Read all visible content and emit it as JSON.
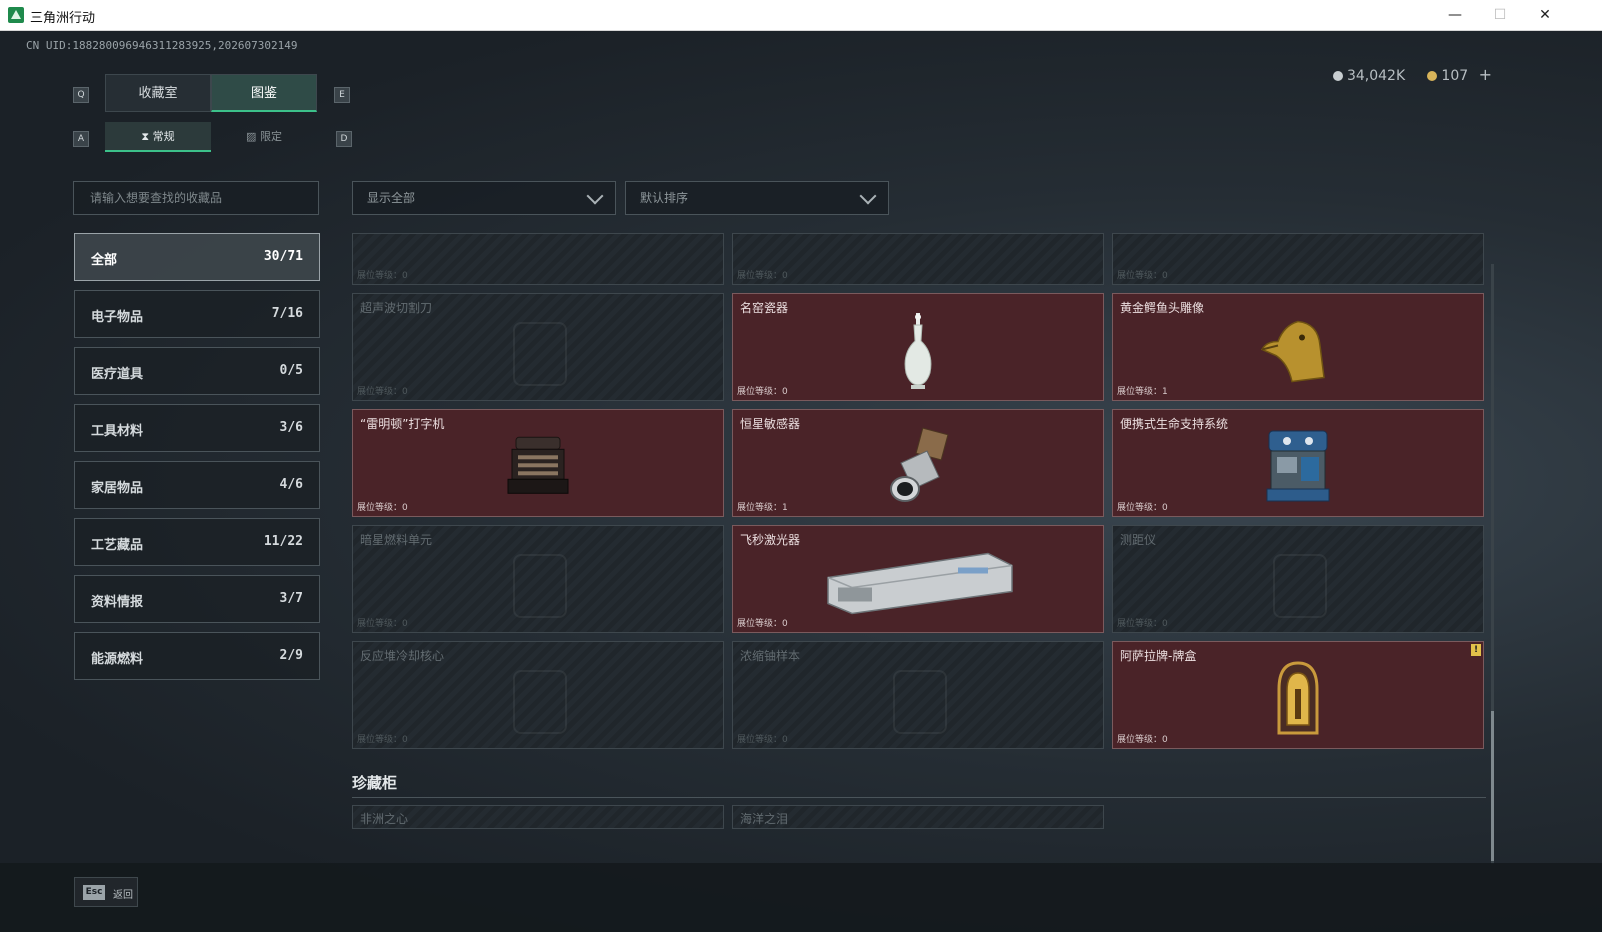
{
  "window": {
    "title": "三角洲行动",
    "minimize": "—",
    "maximize": "☐",
    "close": "✕"
  },
  "header": {
    "uid": "CN UID:188280096946311283925,202607302149",
    "currency": [
      {
        "value": "34,042K",
        "color": "#c8ced1"
      },
      {
        "value": "107",
        "color": "#d8b45a"
      }
    ],
    "add_label": "+"
  },
  "tabs": {
    "key_left": "Q",
    "key_right": "E",
    "items": [
      {
        "label": "收藏室",
        "active": false
      },
      {
        "label": "图鉴",
        "active": true
      }
    ]
  },
  "subtabs": {
    "key_left": "A",
    "key_right": "D",
    "items": [
      {
        "label": "常规",
        "icon": "hourglass-icon",
        "active": true
      },
      {
        "label": "限定",
        "icon": "image-icon",
        "active": false
      }
    ]
  },
  "search": {
    "placeholder": "请输入想要查找的收藏品"
  },
  "filters": {
    "display": "显示全部",
    "sort": "默认排序"
  },
  "categories": [
    {
      "label": "全部",
      "count": "30/71",
      "active": true
    },
    {
      "label": "电子物品",
      "count": "7/16",
      "active": false
    },
    {
      "label": "医疗道具",
      "count": "0/5",
      "active": false
    },
    {
      "label": "工具材料",
      "count": "3/6",
      "active": false
    },
    {
      "label": "家居物品",
      "count": "4/6",
      "active": false
    },
    {
      "label": "工艺藏品",
      "count": "11/22",
      "active": false
    },
    {
      "label": "资料情报",
      "count": "3/7",
      "active": false
    },
    {
      "label": "能源燃料",
      "count": "2/9",
      "active": false
    }
  ],
  "grid": {
    "partial_row": [
      {
        "level": "展位等级：0"
      },
      {
        "level": "展位等级：0"
      },
      {
        "level": "展位等级：0"
      }
    ],
    "items": [
      {
        "name": "超声波切割刀",
        "level": "展位等级：0",
        "owned": false
      },
      {
        "name": "名窑瓷器",
        "level": "展位等级：0",
        "owned": true,
        "icon": "vase-icon"
      },
      {
        "name": "黄金鳄鱼头雕像",
        "level": "展位等级：1",
        "owned": true,
        "icon": "gold-crocodile-icon"
      },
      {
        "name": "“雷明顿”打字机",
        "level": "展位等级：0",
        "owned": true,
        "icon": "typewriter-icon"
      },
      {
        "name": "恒星敏感器",
        "level": "展位等级：1",
        "owned": true,
        "icon": "star-sensor-icon"
      },
      {
        "name": "便携式生命支持系统",
        "level": "展位等级：0",
        "owned": true,
        "icon": "life-support-icon"
      },
      {
        "name": "暗星燃料单元",
        "level": "展位等级：0",
        "owned": false
      },
      {
        "name": "飞秒激光器",
        "level": "展位等级：0",
        "owned": true,
        "icon": "laser-icon"
      },
      {
        "name": "测距仪",
        "level": "展位等级：0",
        "owned": false
      },
      {
        "name": "反应堆冷却核心",
        "level": "展位等级：0",
        "owned": false
      },
      {
        "name": "浓缩铀样本",
        "level": "展位等级：0",
        "owned": false
      },
      {
        "name": "阿萨拉牌-牌盒",
        "level": "展位等级：0",
        "owned": true,
        "icon": "card-box-icon",
        "badge": "!"
      }
    ]
  },
  "section": {
    "title": "珍藏柜",
    "items": [
      {
        "name": "非洲之心"
      },
      {
        "name": "海洋之泪"
      }
    ]
  },
  "footer": {
    "esc_key": "Esc",
    "back_label": "返回"
  }
}
